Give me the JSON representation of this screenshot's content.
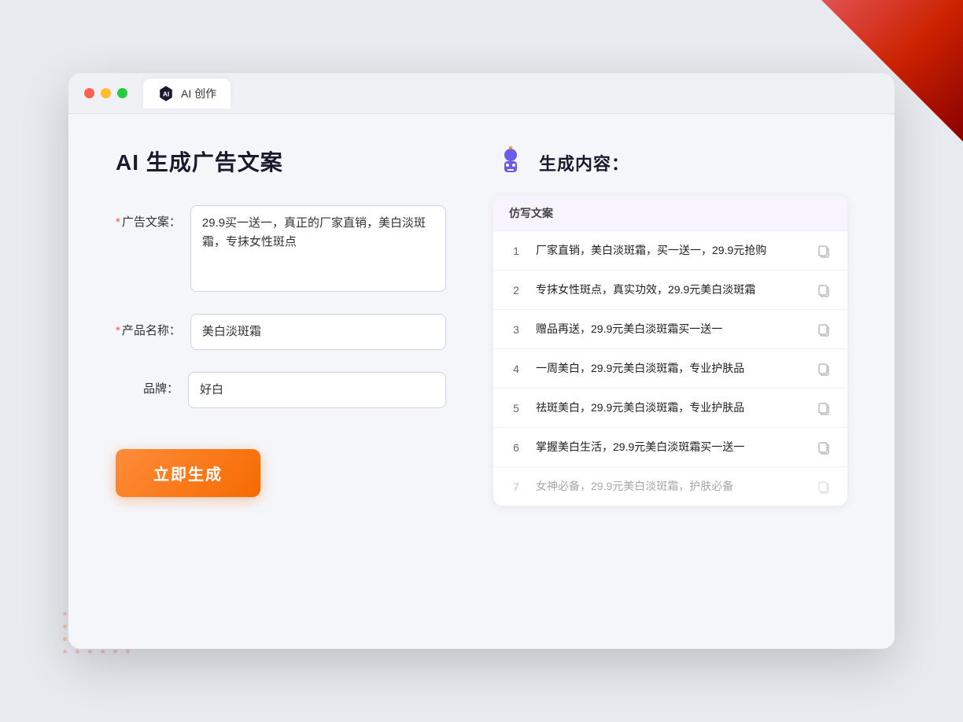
{
  "window": {
    "tab_label": "AI 创作"
  },
  "header": {
    "title": "AI 生成广告文案"
  },
  "form": {
    "ad_copy_label": "广告文案：",
    "ad_copy_required": "*",
    "ad_copy_value": "29.9买一送一，真正的厂家直销，美白淡斑霜，专抹女性斑点",
    "product_name_label": "产品名称：",
    "product_name_required": "*",
    "product_name_value": "美白淡斑霜",
    "brand_label": "品牌：",
    "brand_value": "好白",
    "generate_btn": "立即生成"
  },
  "result": {
    "title": "生成内容：",
    "column_header": "仿写文案",
    "items": [
      {
        "num": "1",
        "text": "厂家直销，美白淡斑霜，买一送一，29.9元抢购",
        "faded": false
      },
      {
        "num": "2",
        "text": "专抹女性斑点，真实功效，29.9元美白淡斑霜",
        "faded": false
      },
      {
        "num": "3",
        "text": "赠品再送，29.9元美白淡斑霜买一送一",
        "faded": false
      },
      {
        "num": "4",
        "text": "一周美白，29.9元美白淡斑霜，专业护肤品",
        "faded": false
      },
      {
        "num": "5",
        "text": "祛斑美白，29.9元美白淡斑霜，专业护肤品",
        "faded": false
      },
      {
        "num": "6",
        "text": "掌握美白生活，29.9元美白淡斑霜买一送一",
        "faded": false
      },
      {
        "num": "7",
        "text": "女神必备，29.9元美白淡斑霜，护肤必备",
        "faded": true
      }
    ]
  }
}
